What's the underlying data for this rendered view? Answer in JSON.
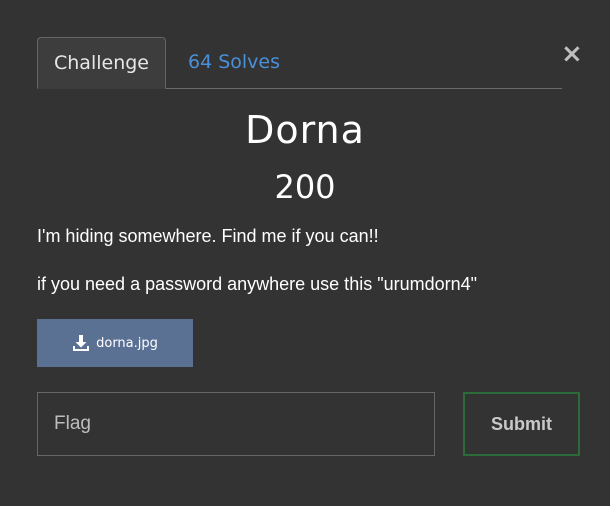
{
  "modal": {
    "close_label": "×",
    "tabs": [
      {
        "label": "Challenge",
        "active": true
      },
      {
        "label": "64 Solves",
        "active": false
      }
    ],
    "challenge": {
      "name": "Dorna",
      "value": "200",
      "description": [
        "I'm hiding somewhere. Find me if you can!!",
        "if you need a password anywhere use this \"urumdorn4\""
      ],
      "file": {
        "label": "dorna.jpg",
        "icon": "download-icon"
      }
    },
    "flag_input": {
      "placeholder": "Flag",
      "value": ""
    },
    "submit_label": "Submit"
  },
  "colors": {
    "background": "#333333",
    "link": "#4a90d9",
    "file_button": "#5b7194",
    "submit_border": "#2e6b3a"
  }
}
